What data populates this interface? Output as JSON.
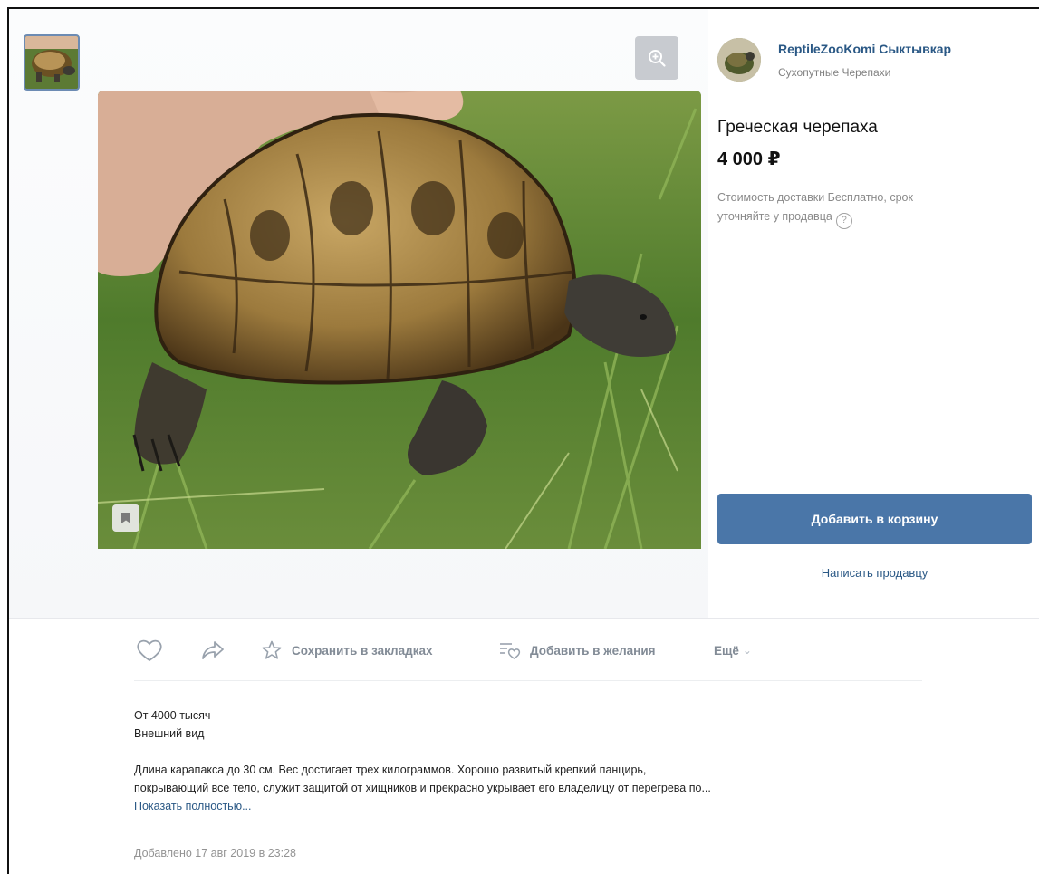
{
  "seller": {
    "name": "ReptileZooKomi Сыктывкар",
    "category": "Сухопутные Черепахи"
  },
  "product": {
    "title": "Греческая черепаха",
    "price": "4 000 ₽",
    "delivery_line1": "Стоимость доставки Бесплатно, срок",
    "delivery_line2": "уточняйте у продавца",
    "help_glyph": "?"
  },
  "buttons": {
    "add_to_cart": "Добавить в корзину",
    "write_seller": "Написать продавцу"
  },
  "actions": {
    "save_bookmarks": "Сохранить в закладках",
    "add_wishlist": "Добавить в желания",
    "more": "Ещё",
    "more_caret": "⌄"
  },
  "description": {
    "line1": "От 4000 тысяч",
    "line2": "Внешний вид",
    "line3": "Длина карапакса до 30 см. Вес достигает трех килограммов. Хорошо развитый крепкий панцирь,",
    "line4": "покрывающий все тело, служит защитой от хищников и прекрасно укрывает его владелицу от перегрева по...",
    "show_full": "Показать полностью..."
  },
  "added_date": "Добавлено 17 авг 2019 в 23:28",
  "colors": {
    "accent": "#4a76a8",
    "link": "#2a5885",
    "muted": "#828282"
  },
  "icons": [
    "zoom-icon",
    "bookmark-icon",
    "like-icon",
    "share-icon",
    "star-icon",
    "wishlist-icon",
    "help-icon"
  ]
}
